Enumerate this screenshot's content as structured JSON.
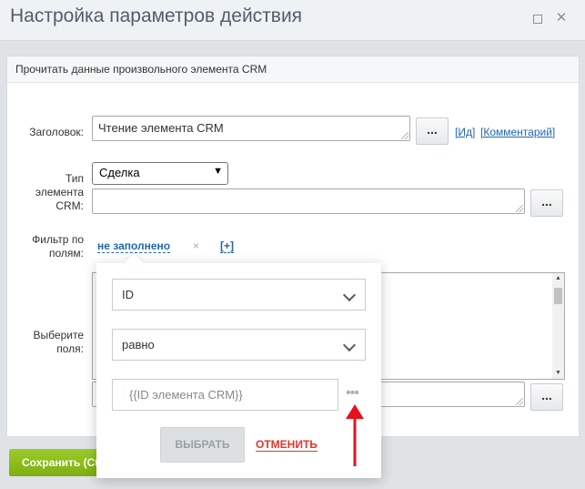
{
  "window": {
    "title": "Настройка параметров действия"
  },
  "panel": {
    "header": "Прочитать данные произвольного элемента CRM"
  },
  "form": {
    "title_label": "Заголовок:",
    "title_value": "Чтение элемента CRM",
    "dots": "...",
    "link_id": "[Ид]",
    "link_comment": "[Комментарий]",
    "type_label_1": "Тип",
    "type_label_2": "элемента",
    "type_label_3": "CRM:",
    "type_value": "Сделка",
    "filter_label_1": "Фильтр по",
    "filter_label_2": "полям:",
    "filter_value": "не заполнено",
    "filter_remove": "×",
    "filter_add": "[+]",
    "fields_label_1": "Выберите",
    "fields_label_2": "поля:"
  },
  "popup": {
    "field_value": "ID",
    "operator_value": "равно",
    "input_placeholder": "{{ID элемента CRM}}",
    "more": "•••",
    "choose_button": "ВЫБРАТЬ",
    "cancel_button": "ОТМЕНИТЬ"
  },
  "footer": {
    "save_button": "Сохранить (Ctrl+Enter)"
  },
  "colors": {
    "accent": "#2067b0",
    "save_green": "#8dbc1c",
    "cancel_red": "#e0362a",
    "arrow_red": "#e8111b"
  }
}
